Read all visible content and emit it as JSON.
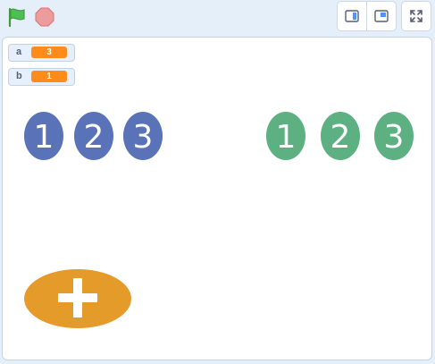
{
  "toolbar": {
    "green_flag": "green-flag-icon",
    "stop": "stop-sign-icon",
    "small_stage": "small-stage-icon",
    "normal_stage": "normal-stage-icon",
    "fullscreen": "fullscreen-icon"
  },
  "monitors": [
    {
      "label": "a",
      "value": "3"
    },
    {
      "label": "b",
      "value": "1"
    }
  ],
  "sprites": {
    "blue_numbers": [
      "1",
      "2",
      "3"
    ],
    "green_numbers": [
      "1",
      "2",
      "3"
    ],
    "plus_button": "plus-icon"
  },
  "colors": {
    "blue_sprite": "#5a73b8",
    "green_sprite": "#5cb082",
    "orange_button": "#e59b2a",
    "monitor_value": "#ff8c1a"
  }
}
